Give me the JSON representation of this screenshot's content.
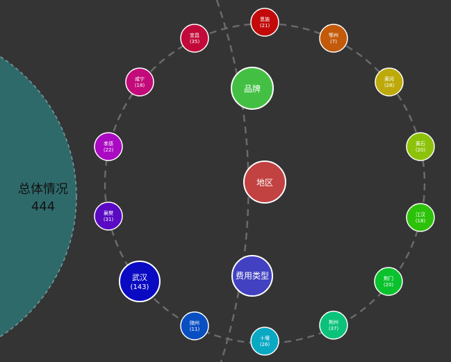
{
  "summary": {
    "title": "总体情况",
    "total": "444",
    "color": "#2f6a6b"
  },
  "dimensions": [
    {
      "key": "brand",
      "label": "品牌",
      "color": "#43c043"
    },
    {
      "key": "region",
      "label": "地区",
      "color": "#c24141"
    },
    {
      "key": "expense",
      "label": "费用类型",
      "color": "#4141c2"
    }
  ],
  "regions": [
    {
      "name": "恩施",
      "count": "(21)",
      "color": "#c20a0a"
    },
    {
      "name": "鄂州",
      "count": "(7)",
      "color": "#c25a0a"
    },
    {
      "name": "黄冈",
      "count": "(28)",
      "color": "#bdaa0a"
    },
    {
      "name": "黄石",
      "count": "(20)",
      "color": "#8cc20a"
    },
    {
      "name": "江汉",
      "count": "(18)",
      "color": "#2dc20a"
    },
    {
      "name": "荆门",
      "count": "(20)",
      "color": "#0ac22d"
    },
    {
      "name": "荆州",
      "count": "(37)",
      "color": "#0ac27a"
    },
    {
      "name": "十堰",
      "count": "(26)",
      "color": "#0aa8c2"
    },
    {
      "name": "随州",
      "count": "(11)",
      "color": "#0a4fc2"
    },
    {
      "name": "武汉",
      "count": "(143)",
      "color": "#0a0ac2"
    },
    {
      "name": "襄樊",
      "count": "(31)",
      "color": "#5a0ac2"
    },
    {
      "name": "孝感",
      "count": "(22)",
      "color": "#aa0ac2"
    },
    {
      "name": "咸宁",
      "count": "(18)",
      "color": "#c20a7a"
    },
    {
      "name": "宜昌",
      "count": "(35)",
      "color": "#c20a3a"
    }
  ]
}
